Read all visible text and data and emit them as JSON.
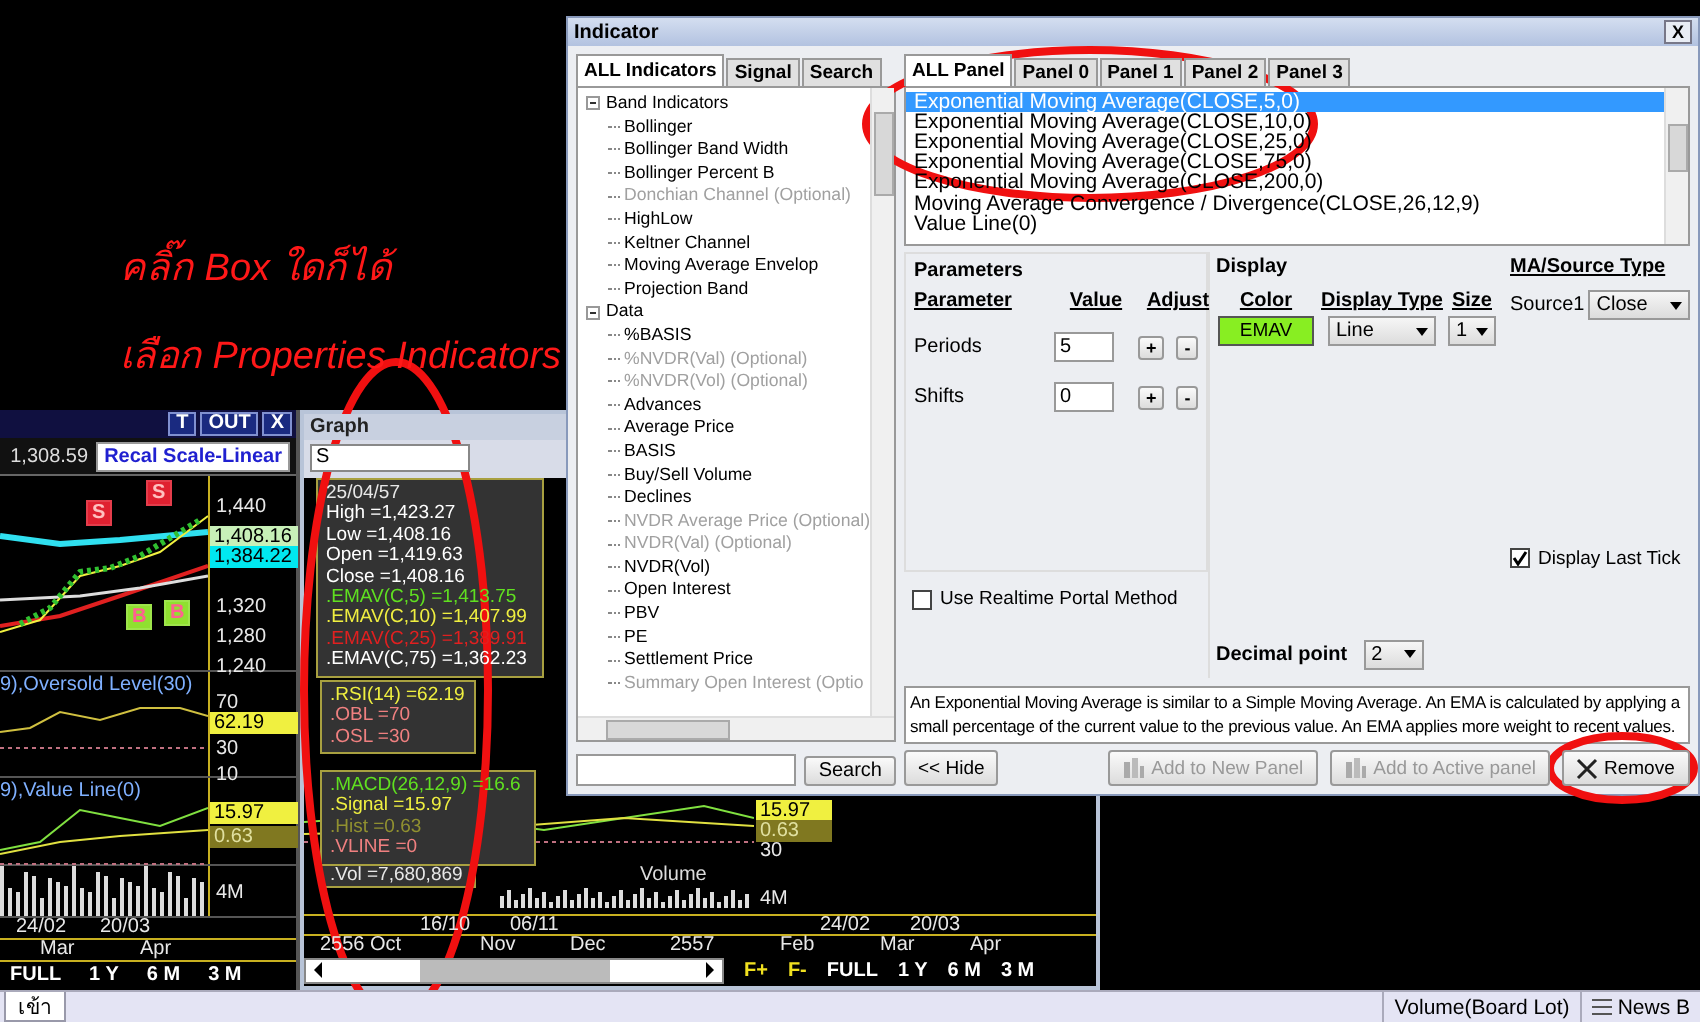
{
  "annotation": {
    "click_note": "คลิ๊ก Box ใดก็ได้",
    "select_note": "เลือก Properties Indicators"
  },
  "chart_window": {
    "buttons": [
      "T",
      "OUT",
      "X"
    ],
    "last_price": "1,308.59",
    "rescale_button": "Recal Scale-Linear",
    "price_labels": [
      "1,440",
      "1,320",
      "1,280",
      "1,240"
    ],
    "price_tags": [
      {
        "text": "1,408.16",
        "color": "#c8f0b8"
      },
      {
        "text": "1,384.22",
        "color": "#00e8f0"
      }
    ],
    "signals": [
      {
        "text": "S",
        "kind": "sell"
      },
      {
        "text": "S",
        "kind": "sell"
      },
      {
        "text": "B",
        "kind": "buy"
      },
      {
        "text": "B",
        "kind": "buy"
      }
    ],
    "rsi_legend": "9),Oversold Level(30)",
    "rsi_labels": [
      "70",
      "30",
      "10"
    ],
    "rsi_tag": "62.19",
    "macd_legend": "9),Value Line(0)",
    "macd_tags": [
      {
        "text": "15.97",
        "kind": "signal"
      },
      {
        "text": "0.63",
        "kind": "hist"
      }
    ],
    "volume_label": "4M",
    "dates": [
      "24/02",
      "20/03"
    ],
    "months": [
      "Mar",
      "Apr"
    ],
    "ranges": [
      "FULL",
      "1 Y",
      "6 M",
      "3 M"
    ]
  },
  "graph_window": {
    "title": "Graph",
    "symbol": "S",
    "data_box": {
      "date": "25/04/57",
      "lines": [
        {
          "text": "High =1,423.27",
          "color": "#ffffff"
        },
        {
          "text": "Low =1,408.16",
          "color": "#ffffff"
        },
        {
          "text": "Open =1,419.63",
          "color": "#ffffff"
        },
        {
          "text": "Close =1,408.16",
          "color": "#ffffff"
        },
        {
          "text": ".EMAV(C,5) =1,413.75",
          "color": "#60e020"
        },
        {
          "text": ".EMAV(C,10) =1,407.99",
          "color": "#f0f040"
        },
        {
          "text": ".EMAV(C,25) =1,389.91",
          "color": "#e02020"
        },
        {
          "text": ".EMAV(C,75) =1,362.23",
          "color": "#ffffff"
        }
      ]
    },
    "rsi_box": [
      {
        "text": ".RSI(14) =62.19",
        "color": "#f0f040"
      },
      {
        "text": ".OBL =70",
        "color": "#f08080"
      },
      {
        "text": ".OSL =30",
        "color": "#f08080"
      }
    ],
    "macd_box": [
      {
        "text": ".MACD(26,12,9) =16.6",
        "color": "#60e020"
      },
      {
        "text": ".Signal =15.97",
        "color": "#f0f040"
      },
      {
        "text": ".Hist =0.63",
        "color": "#909030"
      },
      {
        "text": ".VLINE =0",
        "color": "#f08080"
      }
    ],
    "volume_box": ".Vol =7,680,869",
    "pane_legend": "Volume",
    "axis_tags": [
      {
        "text": "15.97",
        "kind": "signal"
      },
      {
        "text": "0.63",
        "kind": "hist"
      },
      {
        "text": "30",
        "kind": "plain"
      },
      {
        "text": "4M",
        "kind": "plain"
      }
    ],
    "dates": [
      "16/10",
      "06/11",
      "24/02",
      "20/03"
    ],
    "months": [
      "2556",
      "Oct",
      "Nov",
      "Dec",
      "2557",
      "Feb",
      "Mar",
      "Apr"
    ],
    "zoom_buttons": [
      "F+",
      "F-"
    ],
    "ranges": [
      "FULL",
      "1 Y",
      "6 M",
      "3 M"
    ]
  },
  "indicator_dialog": {
    "title": "Indicator",
    "close": "X",
    "left_tabs": [
      {
        "label": "ALL Indicators",
        "selected": true
      },
      {
        "label": "Signal",
        "selected": false
      },
      {
        "label": "Search",
        "selected": false
      }
    ],
    "tree": [
      {
        "label": "Band Indicators",
        "expanded": true,
        "children": [
          {
            "label": "Bollinger",
            "disabled": false
          },
          {
            "label": "Bollinger Band Width",
            "disabled": false
          },
          {
            "label": "Bollinger Percent B",
            "disabled": false
          },
          {
            "label": "Donchian Channel (Optional)",
            "disabled": true
          },
          {
            "label": "HighLow",
            "disabled": false
          },
          {
            "label": "Keltner Channel",
            "disabled": false
          },
          {
            "label": "Moving Average Envelop",
            "disabled": false
          },
          {
            "label": "Projection Band",
            "disabled": false
          }
        ]
      },
      {
        "label": "Data",
        "expanded": true,
        "children": [
          {
            "label": "%BASIS",
            "disabled": false
          },
          {
            "label": "%NVDR(Val) (Optional)",
            "disabled": true
          },
          {
            "label": "%NVDR(Vol) (Optional)",
            "disabled": true
          },
          {
            "label": "Advances",
            "disabled": false
          },
          {
            "label": "Average Price",
            "disabled": false
          },
          {
            "label": "BASIS",
            "disabled": false
          },
          {
            "label": "Buy/Sell Volume",
            "disabled": false
          },
          {
            "label": "Declines",
            "disabled": false
          },
          {
            "label": "NVDR Average Price (Optional)",
            "disabled": true
          },
          {
            "label": "NVDR(Val) (Optional)",
            "disabled": true
          },
          {
            "label": "NVDR(Vol)",
            "disabled": false
          },
          {
            "label": "Open Interest",
            "disabled": false
          },
          {
            "label": "PBV",
            "disabled": false
          },
          {
            "label": "PE",
            "disabled": false
          },
          {
            "label": "Settlement Price",
            "disabled": false
          },
          {
            "label": "Summary Open Interest (Optio",
            "disabled": true
          }
        ]
      }
    ],
    "search_button": "Search",
    "panel_tabs": [
      {
        "label": "ALL Panel",
        "selected": true
      },
      {
        "label": "Panel 0",
        "selected": false
      },
      {
        "label": "Panel 1",
        "selected": false
      },
      {
        "label": "Panel 2",
        "selected": false
      },
      {
        "label": "Panel 3",
        "selected": false
      }
    ],
    "indicators": [
      {
        "label": "Exponential Moving Average(CLOSE,5,0)",
        "selected": true
      },
      {
        "label": "Exponential Moving Average(CLOSE,10,0)",
        "selected": false
      },
      {
        "label": "Exponential Moving Average(CLOSE,25,0)",
        "selected": false
      },
      {
        "label": "Exponential Moving Average(CLOSE,75,0)",
        "selected": false
      },
      {
        "label": "Exponential Moving Average(CLOSE,200,0)",
        "selected": false
      },
      {
        "label": "Moving Average Convergence / Divergence(CLOSE,26,12,9)",
        "selected": false
      },
      {
        "label": "Value Line(0)",
        "selected": false
      }
    ],
    "parameters": {
      "title": "Parameters",
      "headers": [
        "Parameter",
        "Value",
        "Adjust"
      ],
      "rows": [
        {
          "name": "Periods",
          "value": "5",
          "plus": "+",
          "minus": "-"
        },
        {
          "name": "Shifts",
          "value": "0",
          "plus": "+",
          "minus": "-"
        }
      ]
    },
    "display": {
      "title": "Display",
      "headers": [
        "Color",
        "Display Type",
        "Size"
      ],
      "color_label": "EMAV",
      "color": "#88ee22",
      "display_type": "Line",
      "size": "1"
    },
    "source": {
      "title": "MA/Source Type",
      "label": "Source1",
      "value": "Close"
    },
    "display_last_tick": {
      "label": "Display Last Tick",
      "checked": true
    },
    "realtime_portal": {
      "label": "Use Realtime Portal Method",
      "checked": false
    },
    "decimal_point": {
      "label": "Decimal point",
      "value": "2"
    },
    "description": "An Exponential Moving Average is similar to a Simple Moving Average. An EMA is calculated by applying a small percentage of the current value to the previous value. An EMA applies more weight to recent values.",
    "buttons": [
      {
        "label": "<< Hide",
        "disabled": false,
        "kind": "hide"
      },
      {
        "label": "Add to New Panel",
        "disabled": true,
        "kind": "add"
      },
      {
        "label": "Add to Active panel",
        "disabled": true,
        "kind": "add"
      },
      {
        "label": "Remove",
        "disabled": false,
        "kind": "remove"
      }
    ]
  },
  "status_bar": {
    "tab": "เข้า",
    "items": [
      {
        "label": "Volume(Board Lot)",
        "kind": "plain"
      },
      {
        "label": "News B",
        "kind": "news"
      }
    ]
  }
}
